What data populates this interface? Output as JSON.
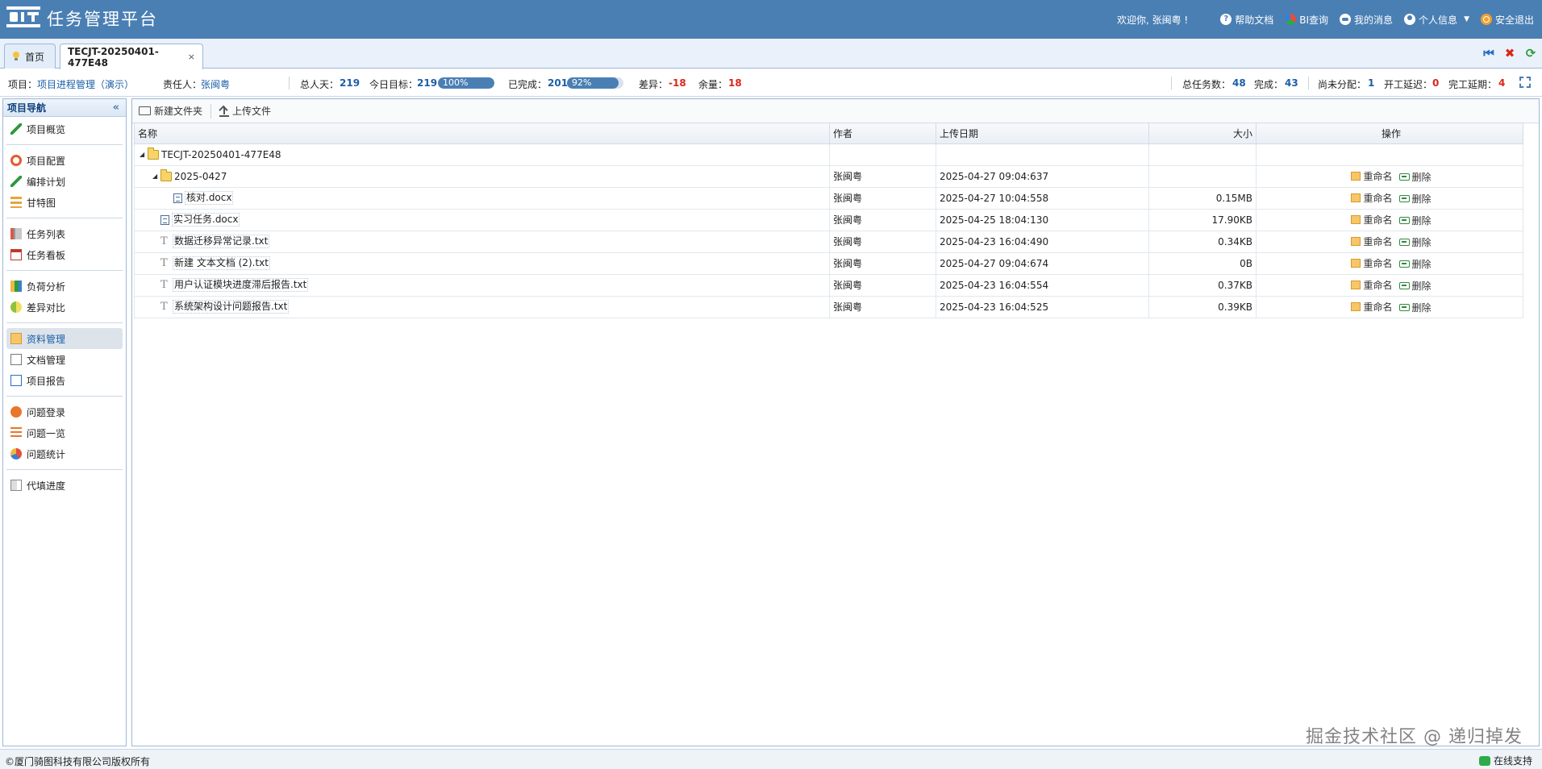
{
  "header": {
    "app_title": "任务管理平台",
    "welcome": "欢迎你, 张闽粤 !",
    "links": {
      "help": "帮助文档",
      "bi": "BI查询",
      "messages": "我的消息",
      "profile": "个人信息",
      "logout": "安全退出"
    }
  },
  "tabs": [
    {
      "label": "首页"
    },
    {
      "label": "TECJT-20250401-477E48",
      "close": "×"
    }
  ],
  "info": {
    "project_label": "项目：",
    "project_value": "项目进程管理（演示）",
    "owner_label": "责任人：",
    "owner_value": "张闽粤",
    "total_days_label": "总人天：",
    "total_days": "219",
    "today_target_label": "今日目标：",
    "today_target": "219",
    "today_target_pct": "100%",
    "today_target_fraction": 1.0,
    "completed_label": "已完成：",
    "completed": "201",
    "completed_pct": "92%",
    "completed_fraction": 0.92,
    "diff_label": "差异：",
    "diff": "-18",
    "remain_label": "余量：",
    "remain": "18",
    "total_tasks_label": "总任务数：",
    "total_tasks": "48",
    "done_label": "完成：",
    "done": "43",
    "unassigned_label": "尚未分配：",
    "unassigned": "1",
    "start_delay_label": "开工延迟：",
    "start_delay": "0",
    "finish_delay_label": "完工延期：",
    "finish_delay": "4"
  },
  "sidebar": {
    "title": "项目导航",
    "groups": [
      [
        {
          "label": "项目概览",
          "icon": "pencil-icon"
        }
      ],
      [
        {
          "label": "项目配置",
          "icon": "gear-icon"
        },
        {
          "label": "编排计划",
          "icon": "pencil-icon"
        },
        {
          "label": "甘特图",
          "icon": "gantt-icon"
        }
      ],
      [
        {
          "label": "任务列表",
          "icon": "list-icon"
        },
        {
          "label": "任务看板",
          "icon": "calendar-icon"
        }
      ],
      [
        {
          "label": "负荷分析",
          "icon": "chart-icon"
        },
        {
          "label": "差异对比",
          "icon": "contrast-icon"
        }
      ],
      [
        {
          "label": "资料管理",
          "icon": "folder-icon",
          "active": true
        },
        {
          "label": "文档管理",
          "icon": "document-icon"
        },
        {
          "label": "项目报告",
          "icon": "report-icon"
        }
      ],
      [
        {
          "label": "问题登录",
          "icon": "bug-icon"
        },
        {
          "label": "问题一览",
          "icon": "bullet-list-icon"
        },
        {
          "label": "问题统计",
          "icon": "pie-icon"
        }
      ],
      [
        {
          "label": "代填进度",
          "icon": "progress-icon"
        }
      ]
    ]
  },
  "toolbar": {
    "new_folder": "新建文件夹",
    "upload": "上传文件"
  },
  "table": {
    "columns": [
      "名称",
      "作者",
      "上传日期",
      "大小",
      "操作"
    ],
    "rename_label": "重命名",
    "delete_label": "删除",
    "rows": [
      {
        "name": "TECJT-20250401-477E48",
        "type": "folder",
        "level": 0,
        "expander": "◢",
        "author": "",
        "date": "",
        "size": "",
        "ops": false
      },
      {
        "name": "2025-0427",
        "type": "folder",
        "level": 1,
        "expander": "◢",
        "author": "张闽粤",
        "date": "2025-04-27 09:04:637",
        "size": "",
        "ops": true
      },
      {
        "name": "核对.docx",
        "type": "doc",
        "level": 2,
        "expander": "",
        "author": "张闽粤",
        "date": "2025-04-27 10:04:558",
        "size": "0.15MB",
        "ops": true
      },
      {
        "name": "实习任务.docx",
        "type": "doc",
        "level": 1,
        "expander": "",
        "author": "张闽粤",
        "date": "2025-04-25 18:04:130",
        "size": "17.90KB",
        "ops": true
      },
      {
        "name": "数据迁移异常记录.txt",
        "type": "txt",
        "level": 1,
        "expander": "",
        "author": "张闽粤",
        "date": "2025-04-23 16:04:490",
        "size": "0.34KB",
        "ops": true
      },
      {
        "name": "新建 文本文档 (2).txt",
        "type": "txt",
        "level": 1,
        "expander": "",
        "author": "张闽粤",
        "date": "2025-04-27 09:04:674",
        "size": "0B",
        "ops": true
      },
      {
        "name": "用户认证模块进度滞后报告.txt",
        "type": "txt",
        "level": 1,
        "expander": "",
        "author": "张闽粤",
        "date": "2025-04-23 16:04:554",
        "size": "0.37KB",
        "ops": true
      },
      {
        "name": "系统架构设计问题报告.txt",
        "type": "txt",
        "level": 1,
        "expander": "",
        "author": "张闽粤",
        "date": "2025-04-23 16:04:525",
        "size": "0.39KB",
        "ops": true
      }
    ]
  },
  "footer": {
    "copyright": "©厦门骑图科技有限公司版权所有",
    "support": "在线支持"
  },
  "watermark": "掘金技术社区 @ 递归掉发"
}
